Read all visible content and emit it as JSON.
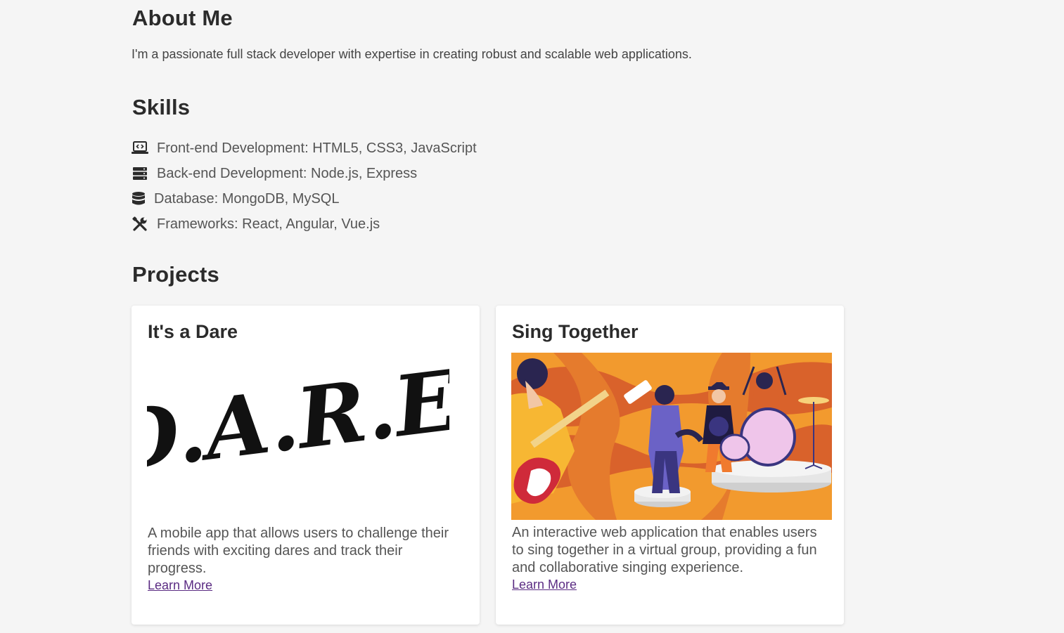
{
  "about": {
    "title": "About Me",
    "text": "I'm a passionate full stack developer with expertise in creating robust and scalable web applications."
  },
  "skills": {
    "title": "Skills",
    "items": [
      {
        "icon": "laptop-code-icon",
        "label": "Front-end Development: HTML5, CSS3, JavaScript"
      },
      {
        "icon": "server-icon",
        "label": "Back-end Development: Node.js, Express"
      },
      {
        "icon": "database-icon",
        "label": "Database: MongoDB, MySQL"
      },
      {
        "icon": "tools-icon",
        "label": "Frameworks: React, Angular, Vue.js"
      }
    ]
  },
  "projects": {
    "title": "Projects",
    "items": [
      {
        "title": "It's a Dare",
        "logo_text": "D.A.R.E.",
        "description": "A mobile app that allows users to challenge their friends with exciting dares and track their progress.",
        "link": "Learn More"
      },
      {
        "title": "Sing Together",
        "description": "An interactive web application that enables users to sing together in a virtual group, providing a fun and collaborative singing experience.",
        "link": "Learn More"
      }
    ]
  },
  "colors": {
    "background": "#f5f5f5",
    "card": "#ffffff",
    "heading": "#2b2b2b",
    "link": "#5b2c83",
    "art_orange": "#f29a2e",
    "art_dark_orange": "#d9622b"
  }
}
